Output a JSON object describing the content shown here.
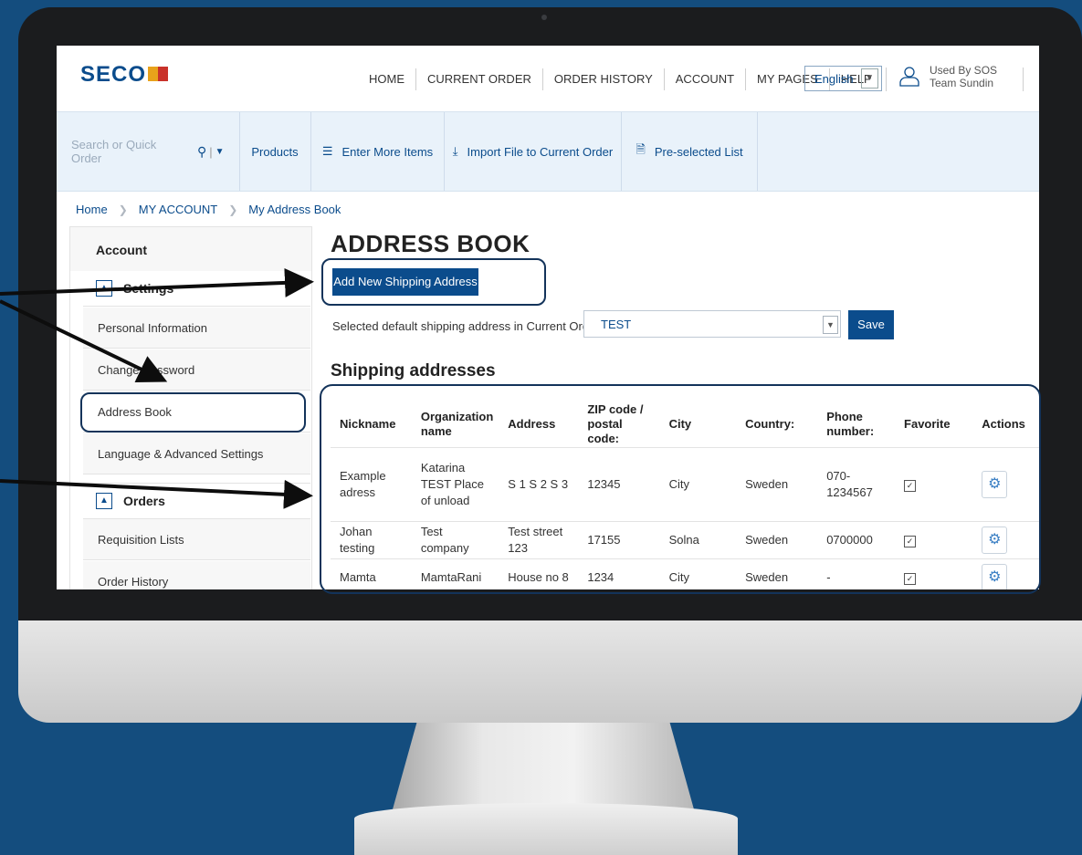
{
  "header": {
    "logo": "SECO",
    "nav": [
      "HOME",
      "CURRENT ORDER",
      "ORDER HISTORY",
      "ACCOUNT",
      "MY PAGES",
      "HELP"
    ],
    "language": "English",
    "user_line1": "Used By SOS",
    "user_line2": "Team Sundin"
  },
  "toolbar": {
    "search_placeholder": "Search or Quick Order",
    "products": "Products",
    "enter_more_items": "Enter More Items",
    "import_file": "Import File to Current Order",
    "preselected_list": "Pre-selected List"
  },
  "breadcrumb": [
    "Home",
    "MY ACCOUNT",
    "My Address Book"
  ],
  "sidebar": {
    "heading": "Account",
    "settings": "Settings",
    "settings_items": [
      "Personal Information",
      "Change Password",
      "Address Book",
      "Language & Advanced Settings"
    ],
    "orders": "Orders",
    "orders_items": [
      "Requisition Lists",
      "Order History"
    ]
  },
  "main": {
    "title": "ADDRESS BOOK",
    "add_button": "Add New Shipping Address",
    "default_label": "Selected default shipping address in Current Order:",
    "default_value": "TEST",
    "save_button": "Save",
    "shipping_title": "Shipping addresses",
    "columns": [
      "Nickname",
      "Organization name",
      "Address",
      "ZIP code / postal code:",
      "City",
      "Country:",
      "Phone number:",
      "Favorite",
      "Actions"
    ],
    "rows": [
      {
        "nickname": "Example adress",
        "org": "Katarina TEST Place of unload",
        "address": "S 1 S 2 S 3",
        "zip": "12345",
        "city": "City",
        "country": "Sweden",
        "phone": "070-1234567",
        "favorite": true
      },
      {
        "nickname": "Johan testing",
        "org": "Test company",
        "address": "Test street 123",
        "zip": "17155",
        "city": "Solna",
        "country": "Sweden",
        "phone": "0700000",
        "favorite": true
      },
      {
        "nickname": "Mamta",
        "org": "MamtaRani",
        "address": "House no 8",
        "zip": "1234",
        "city": "City",
        "country": "Sweden",
        "phone": "-",
        "favorite": true
      }
    ]
  },
  "colors": {
    "background": "#144d7e",
    "brand": "#0b4c8c",
    "toolbar_bg": "#e9f2fa",
    "highlight": "#13335a"
  }
}
